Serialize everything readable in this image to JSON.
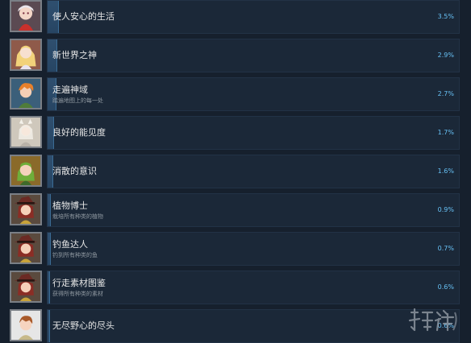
{
  "achievements": [
    {
      "title": "使人安心的生活",
      "description": "",
      "percent": "3.5%",
      "fraction": 0.035,
      "icon": "achievement-icon-girl-red-dress"
    },
    {
      "title": "新世界之神",
      "description": "",
      "percent": "2.9%",
      "fraction": 0.029,
      "icon": "achievement-icon-blonde-girl"
    },
    {
      "title": "走遍神域",
      "description": "踏遍地图上的每一处",
      "percent": "2.7%",
      "fraction": 0.027,
      "icon": "achievement-icon-orange-hair-boy"
    },
    {
      "title": "良好的能见度",
      "description": "",
      "percent": "1.7%",
      "fraction": 0.017,
      "icon": "achievement-icon-white-fox-girl"
    },
    {
      "title": "消散的意识",
      "description": "",
      "percent": "1.6%",
      "fraction": 0.016,
      "icon": "achievement-icon-green-hair-girl"
    },
    {
      "title": "植物博士",
      "description": "栽培所有种类的植物",
      "percent": "0.9%",
      "fraction": 0.009,
      "icon": "achievement-icon-witch-hat-girl"
    },
    {
      "title": "钓鱼达人",
      "description": "钓到所有种类的鱼",
      "percent": "0.7%",
      "fraction": 0.007,
      "icon": "achievement-icon-witch-hat-girl"
    },
    {
      "title": "行走素材图鉴",
      "description": "获得所有种类的素材",
      "percent": "0.6%",
      "fraction": 0.006,
      "icon": "achievement-icon-witch-hat-girl"
    },
    {
      "title": "无尽野心的尽头",
      "description": "",
      "percent": "0.6%",
      "fraction": 0.006,
      "icon": "achievement-icon-brown-hair-boy"
    }
  ],
  "colors": {
    "background": "#16202d",
    "panel": "#1b2838",
    "progress_fill": "#2f4f6f",
    "percent_text": "#67c1f5",
    "title_text": "#e6e6e6",
    "desc_text": "#8f98a0"
  },
  "watermark_icon": "site-logo-watermark"
}
